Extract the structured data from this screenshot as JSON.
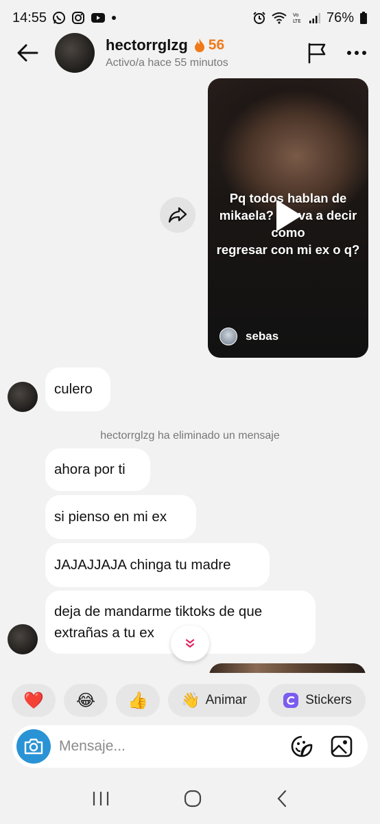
{
  "status_bar": {
    "time": "14:55",
    "battery": "76%",
    "icons": [
      "whatsapp-icon",
      "instagram-icon",
      "youtube-icon",
      "dot-icon",
      "alarm-icon",
      "wifi-icon",
      "volte-icon",
      "signal-icon",
      "battery-icon"
    ]
  },
  "header": {
    "username": "hectorrglzg",
    "streak_count": "56",
    "activity": "Activo/a hace 55 minutos",
    "icons": [
      "back-arrow-icon",
      "flag-icon",
      "more-icon"
    ]
  },
  "video_message": {
    "caption": "Pq todos hablan de\nmikaela? Me va a decir como\nregresar con mi ex o q?",
    "author": "sebas"
  },
  "messages": [
    {
      "text": "culero"
    },
    {
      "text": "ahora por ti"
    },
    {
      "text": "si pienso en mi ex"
    },
    {
      "text": "JAJAJJAJA chinga tu madre"
    },
    {
      "text": "deja de mandarme tiktoks de que extrañas a tu ex"
    }
  ],
  "system_note": "hectorrglzg ha eliminado un mensaje",
  "quick_reactions": {
    "emojis": [
      "❤️",
      "😂",
      "👍"
    ],
    "animar": {
      "emoji": "👋",
      "label": "Animar"
    },
    "stickers": {
      "label": "Stickers"
    }
  },
  "composer": {
    "placeholder": "Mensaje...",
    "value": ""
  },
  "colors": {
    "background": "#f2f2f2",
    "bubble": "#ffffff",
    "streak": "#f07a1a",
    "camera": "#2a93d5",
    "scroll_arrow": "#e0245e"
  }
}
